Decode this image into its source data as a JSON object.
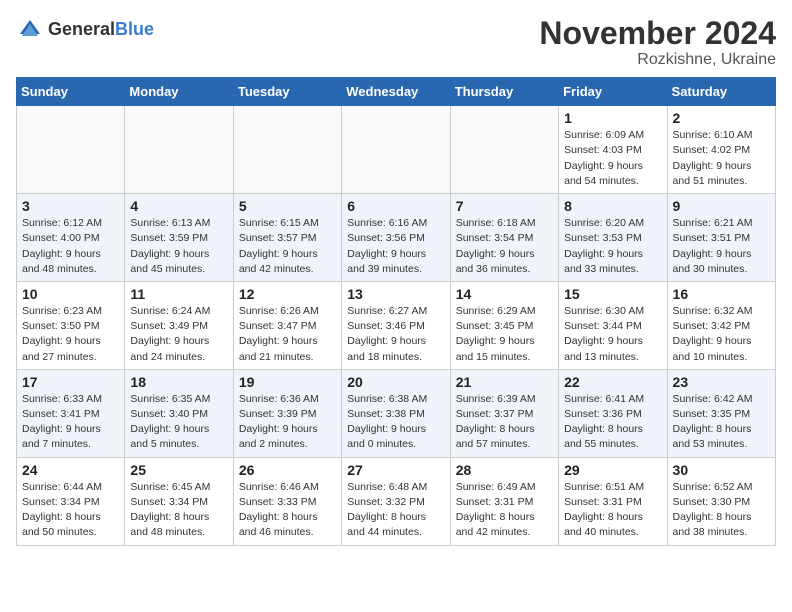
{
  "header": {
    "logo_general": "General",
    "logo_blue": "Blue",
    "month_title": "November 2024",
    "location": "Rozkishne, Ukraine"
  },
  "days_of_week": [
    "Sunday",
    "Monday",
    "Tuesday",
    "Wednesday",
    "Thursday",
    "Friday",
    "Saturday"
  ],
  "weeks": [
    [
      {
        "day": "",
        "info": ""
      },
      {
        "day": "",
        "info": ""
      },
      {
        "day": "",
        "info": ""
      },
      {
        "day": "",
        "info": ""
      },
      {
        "day": "",
        "info": ""
      },
      {
        "day": "1",
        "info": "Sunrise: 6:09 AM\nSunset: 4:03 PM\nDaylight: 9 hours\nand 54 minutes."
      },
      {
        "day": "2",
        "info": "Sunrise: 6:10 AM\nSunset: 4:02 PM\nDaylight: 9 hours\nand 51 minutes."
      }
    ],
    [
      {
        "day": "3",
        "info": "Sunrise: 6:12 AM\nSunset: 4:00 PM\nDaylight: 9 hours\nand 48 minutes."
      },
      {
        "day": "4",
        "info": "Sunrise: 6:13 AM\nSunset: 3:59 PM\nDaylight: 9 hours\nand 45 minutes."
      },
      {
        "day": "5",
        "info": "Sunrise: 6:15 AM\nSunset: 3:57 PM\nDaylight: 9 hours\nand 42 minutes."
      },
      {
        "day": "6",
        "info": "Sunrise: 6:16 AM\nSunset: 3:56 PM\nDaylight: 9 hours\nand 39 minutes."
      },
      {
        "day": "7",
        "info": "Sunrise: 6:18 AM\nSunset: 3:54 PM\nDaylight: 9 hours\nand 36 minutes."
      },
      {
        "day": "8",
        "info": "Sunrise: 6:20 AM\nSunset: 3:53 PM\nDaylight: 9 hours\nand 33 minutes."
      },
      {
        "day": "9",
        "info": "Sunrise: 6:21 AM\nSunset: 3:51 PM\nDaylight: 9 hours\nand 30 minutes."
      }
    ],
    [
      {
        "day": "10",
        "info": "Sunrise: 6:23 AM\nSunset: 3:50 PM\nDaylight: 9 hours\nand 27 minutes."
      },
      {
        "day": "11",
        "info": "Sunrise: 6:24 AM\nSunset: 3:49 PM\nDaylight: 9 hours\nand 24 minutes."
      },
      {
        "day": "12",
        "info": "Sunrise: 6:26 AM\nSunset: 3:47 PM\nDaylight: 9 hours\nand 21 minutes."
      },
      {
        "day": "13",
        "info": "Sunrise: 6:27 AM\nSunset: 3:46 PM\nDaylight: 9 hours\nand 18 minutes."
      },
      {
        "day": "14",
        "info": "Sunrise: 6:29 AM\nSunset: 3:45 PM\nDaylight: 9 hours\nand 15 minutes."
      },
      {
        "day": "15",
        "info": "Sunrise: 6:30 AM\nSunset: 3:44 PM\nDaylight: 9 hours\nand 13 minutes."
      },
      {
        "day": "16",
        "info": "Sunrise: 6:32 AM\nSunset: 3:42 PM\nDaylight: 9 hours\nand 10 minutes."
      }
    ],
    [
      {
        "day": "17",
        "info": "Sunrise: 6:33 AM\nSunset: 3:41 PM\nDaylight: 9 hours\nand 7 minutes."
      },
      {
        "day": "18",
        "info": "Sunrise: 6:35 AM\nSunset: 3:40 PM\nDaylight: 9 hours\nand 5 minutes."
      },
      {
        "day": "19",
        "info": "Sunrise: 6:36 AM\nSunset: 3:39 PM\nDaylight: 9 hours\nand 2 minutes."
      },
      {
        "day": "20",
        "info": "Sunrise: 6:38 AM\nSunset: 3:38 PM\nDaylight: 9 hours\nand 0 minutes."
      },
      {
        "day": "21",
        "info": "Sunrise: 6:39 AM\nSunset: 3:37 PM\nDaylight: 8 hours\nand 57 minutes."
      },
      {
        "day": "22",
        "info": "Sunrise: 6:41 AM\nSunset: 3:36 PM\nDaylight: 8 hours\nand 55 minutes."
      },
      {
        "day": "23",
        "info": "Sunrise: 6:42 AM\nSunset: 3:35 PM\nDaylight: 8 hours\nand 53 minutes."
      }
    ],
    [
      {
        "day": "24",
        "info": "Sunrise: 6:44 AM\nSunset: 3:34 PM\nDaylight: 8 hours\nand 50 minutes."
      },
      {
        "day": "25",
        "info": "Sunrise: 6:45 AM\nSunset: 3:34 PM\nDaylight: 8 hours\nand 48 minutes."
      },
      {
        "day": "26",
        "info": "Sunrise: 6:46 AM\nSunset: 3:33 PM\nDaylight: 8 hours\nand 46 minutes."
      },
      {
        "day": "27",
        "info": "Sunrise: 6:48 AM\nSunset: 3:32 PM\nDaylight: 8 hours\nand 44 minutes."
      },
      {
        "day": "28",
        "info": "Sunrise: 6:49 AM\nSunset: 3:31 PM\nDaylight: 8 hours\nand 42 minutes."
      },
      {
        "day": "29",
        "info": "Sunrise: 6:51 AM\nSunset: 3:31 PM\nDaylight: 8 hours\nand 40 minutes."
      },
      {
        "day": "30",
        "info": "Sunrise: 6:52 AM\nSunset: 3:30 PM\nDaylight: 8 hours\nand 38 minutes."
      }
    ]
  ]
}
